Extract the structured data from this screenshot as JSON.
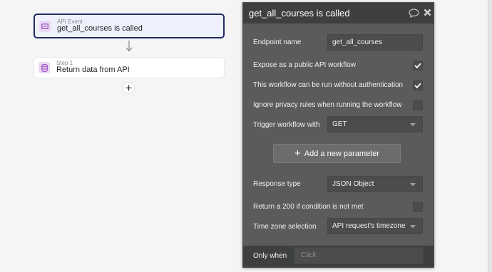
{
  "canvas": {
    "event_card": {
      "kicker": "API Event",
      "title": "get_all_courses is called"
    },
    "step_card": {
      "kicker": "Step 1",
      "title": "Return data from API"
    }
  },
  "panel": {
    "title": "get_all_courses is called",
    "endpoint_name": {
      "label": "Endpoint name",
      "value": "get_all_courses"
    },
    "expose_public": {
      "label": "Expose as a public API workflow",
      "checked": true
    },
    "no_auth": {
      "label": "This workflow can be run without authentication",
      "checked": true
    },
    "ignore_privacy": {
      "label": "Ignore privacy rules when running the workflow",
      "checked": false
    },
    "trigger": {
      "label": "Trigger workflow with",
      "value": "GET"
    },
    "add_parameter_label": "Add a new parameter",
    "response_type": {
      "label": "Response type",
      "value": "JSON Object"
    },
    "return_200": {
      "label": "Return a 200 if condition is not met",
      "checked": false
    },
    "timezone": {
      "label": "Time zone selection",
      "value": "API request's timezone"
    },
    "only_when": {
      "label": "Only when",
      "placeholder": "Click"
    }
  },
  "colors": {
    "accent": "#1e2c63",
    "panel_bg": "#595b5c",
    "panel_header": "#3e3f40",
    "canvas_bg": "#f5f5f5"
  }
}
